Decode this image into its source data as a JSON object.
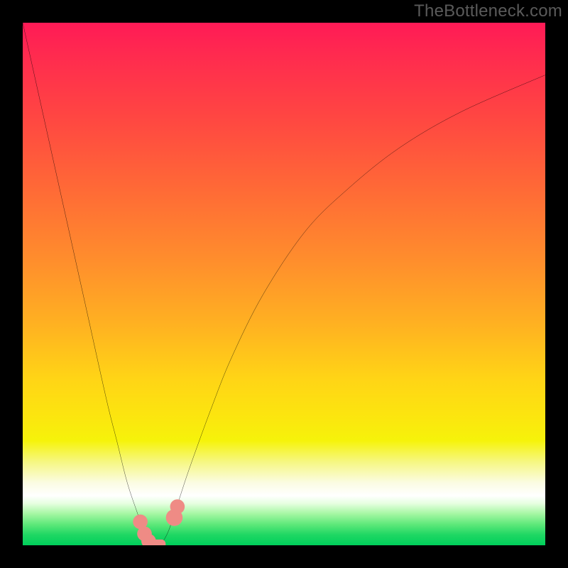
{
  "watermark": {
    "text": "TheBottleneck.com"
  },
  "chart_data": {
    "type": "line",
    "title": "",
    "xlabel": "",
    "ylabel": "",
    "xlim": [
      0,
      100
    ],
    "ylim": [
      0,
      100
    ],
    "grid": false,
    "background_gradient": {
      "stops": [
        {
          "pos": 0,
          "color": "#ff1a56"
        },
        {
          "pos": 18,
          "color": "#ff4642"
        },
        {
          "pos": 46,
          "color": "#ff8f2c"
        },
        {
          "pos": 68,
          "color": "#ffd416"
        },
        {
          "pos": 84,
          "color": "#f6f781"
        },
        {
          "pos": 90,
          "color": "#ffffff"
        },
        {
          "pos": 100,
          "color": "#00cf5b"
        }
      ]
    },
    "series": [
      {
        "name": "bottleneck-curve",
        "color": "#000000",
        "x": [
          0,
          4,
          8,
          12,
          16,
          18,
          20,
          22,
          23,
          24,
          25,
          26,
          27,
          28,
          29,
          30,
          32,
          36,
          40,
          46,
          54,
          62,
          72,
          84,
          100
        ],
        "y": [
          100,
          82,
          64,
          46,
          28,
          20,
          12,
          6,
          3,
          1,
          0,
          0,
          1,
          3,
          6,
          9,
          15,
          26,
          36,
          48,
          60,
          68,
          76,
          83,
          90
        ]
      }
    ],
    "markers": [
      {
        "name": "marker-left-1",
        "shape": "circle",
        "x": 22.5,
        "y": 4.5,
        "r": 1.4,
        "color": "#ef8b85"
      },
      {
        "name": "marker-left-2",
        "shape": "circle",
        "x": 23.3,
        "y": 2.2,
        "r": 1.4,
        "color": "#ef8b85"
      },
      {
        "name": "marker-left-3",
        "shape": "circle",
        "x": 24.1,
        "y": 0.8,
        "r": 1.4,
        "color": "#ef8b85"
      },
      {
        "name": "marker-bottom",
        "shape": "rounded-rect",
        "x": 25.8,
        "y": 0.2,
        "w": 3.1,
        "h": 1.8,
        "color": "#ef8b85"
      },
      {
        "name": "marker-right-1",
        "shape": "circle",
        "x": 29.0,
        "y": 5.3,
        "r": 1.6,
        "color": "#ef8b85"
      },
      {
        "name": "marker-right-2",
        "shape": "circle",
        "x": 29.6,
        "y": 7.4,
        "r": 1.4,
        "color": "#ef8b85"
      }
    ]
  }
}
